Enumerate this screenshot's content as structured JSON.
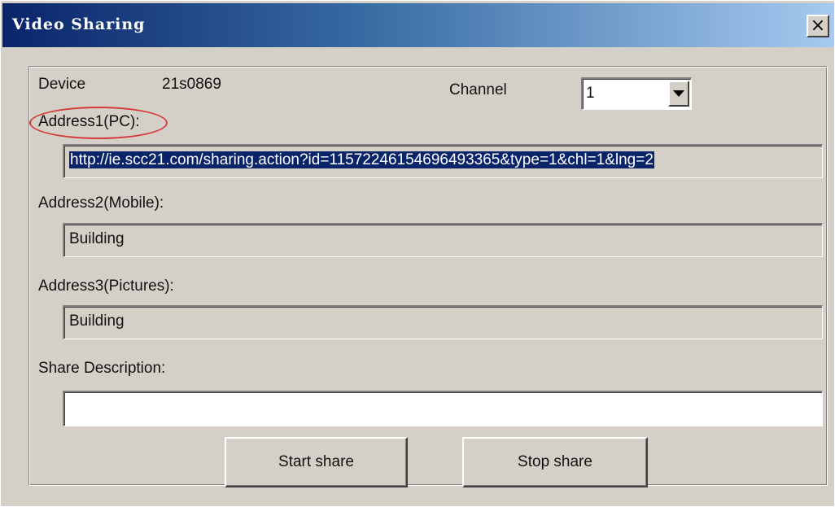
{
  "window": {
    "title": "Video Sharing",
    "close_glyph": "×"
  },
  "device": {
    "label": "Device",
    "value": "21s0869"
  },
  "channel": {
    "label": "Channel",
    "value": "1"
  },
  "address1": {
    "label": "Address1(PC):",
    "value": "http://ie.scc21.com/sharing.action?id=11572246154696493365&type=1&chl=1&lng=2",
    "highlight_color": "#d63a3a"
  },
  "address2": {
    "label": "Address2(Mobile):",
    "value": "Building"
  },
  "address3": {
    "label": "Address3(Pictures):",
    "value": "Building"
  },
  "description": {
    "label": "Share Description:",
    "value": ""
  },
  "buttons": {
    "start": "Start share",
    "stop": "Stop share"
  },
  "icons": {
    "close": "close-icon",
    "dropdown": "chevron-down-icon"
  }
}
